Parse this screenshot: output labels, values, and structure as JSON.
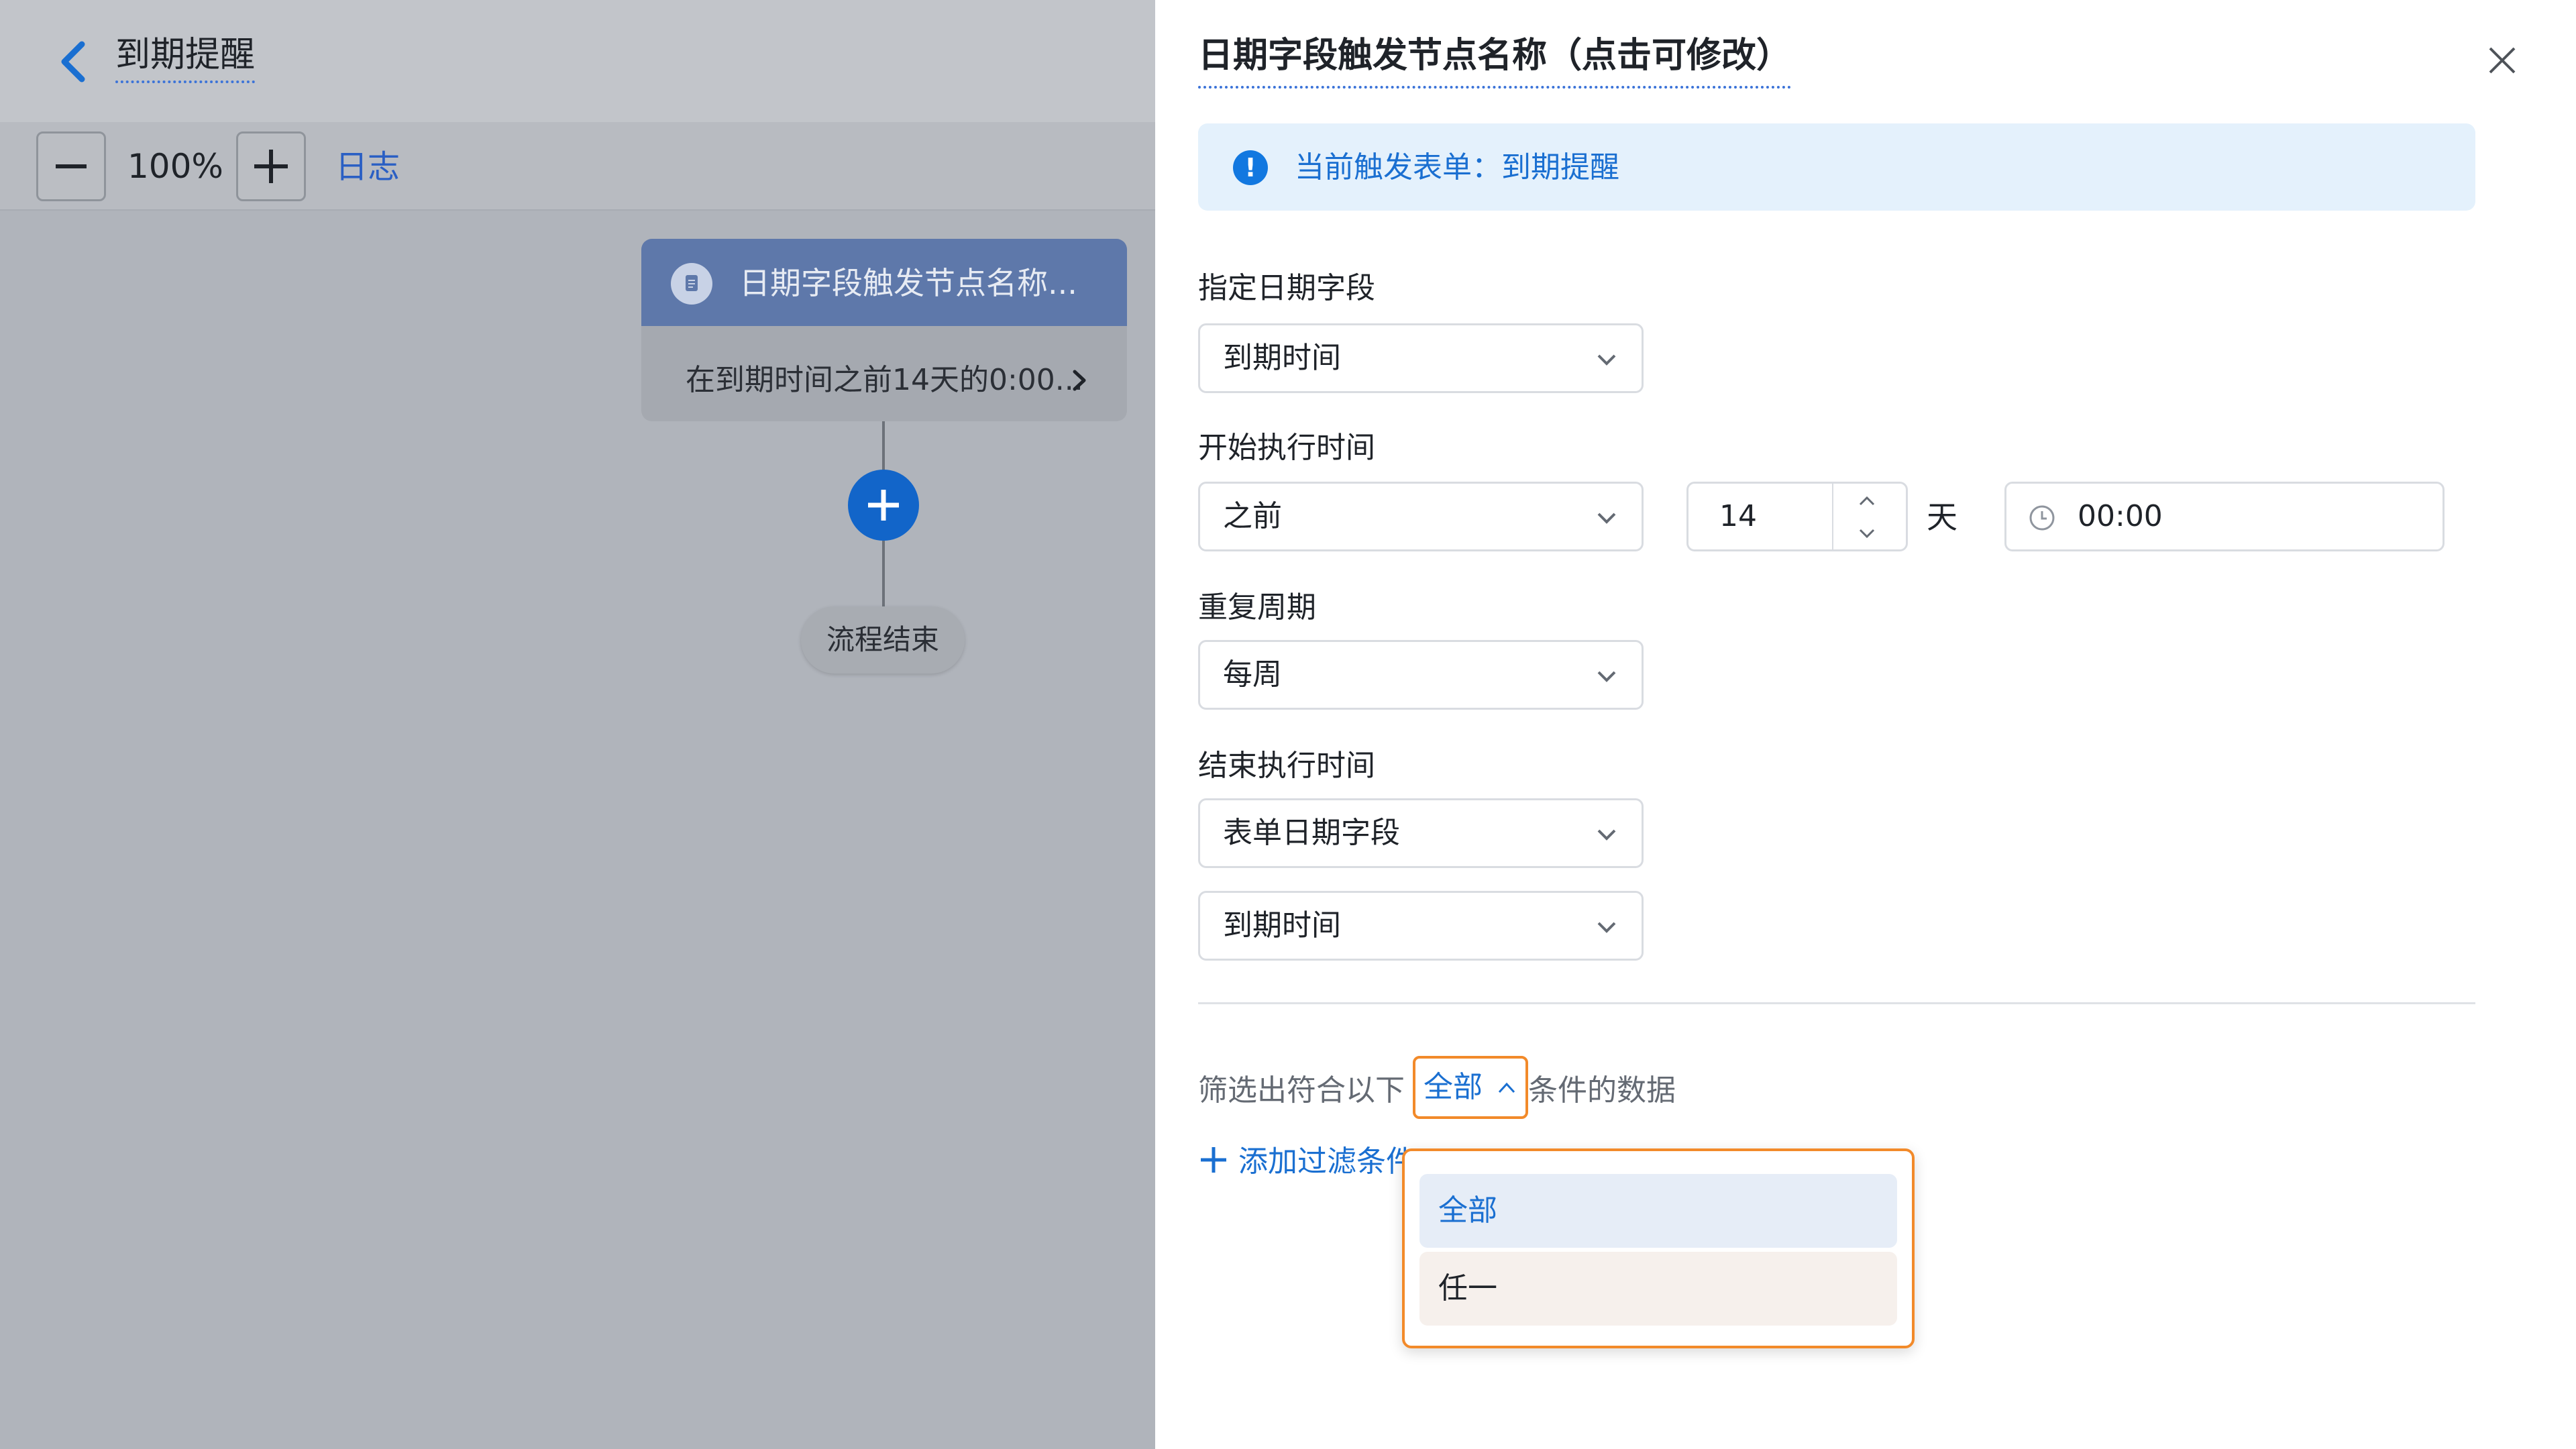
{
  "canvas": {
    "title": "到期提醒",
    "zoom": "100%",
    "log_label": "日志",
    "node": {
      "title": "日期字段触发节点名称...",
      "description": "在到期时间之前14天的0:00..."
    },
    "end_node_label": "流程结束"
  },
  "drawer": {
    "title": "日期字段触发节点名称（点击可修改）",
    "info": "当前触发表单：到期提醒",
    "date_field": {
      "label": "指定日期字段",
      "value": "到期时间"
    },
    "start_time": {
      "label": "开始执行时间",
      "relation": "之前",
      "offset": "14",
      "unit": "天",
      "time": "00:00"
    },
    "repeat": {
      "label": "重复周期",
      "value": "每周"
    },
    "end_time": {
      "label": "结束执行时间",
      "mode": "表单日期字段",
      "field": "到期时间"
    },
    "filter": {
      "prefix": "筛选出符合以下",
      "mode": "全部",
      "suffix": "条件的数据",
      "add_label": "添加过滤条件",
      "options": [
        "全部",
        "任一"
      ]
    }
  },
  "colors": {
    "accent": "#1a6fd1",
    "focus_border": "#f28a2a",
    "overlay": "#b0b4bb"
  }
}
